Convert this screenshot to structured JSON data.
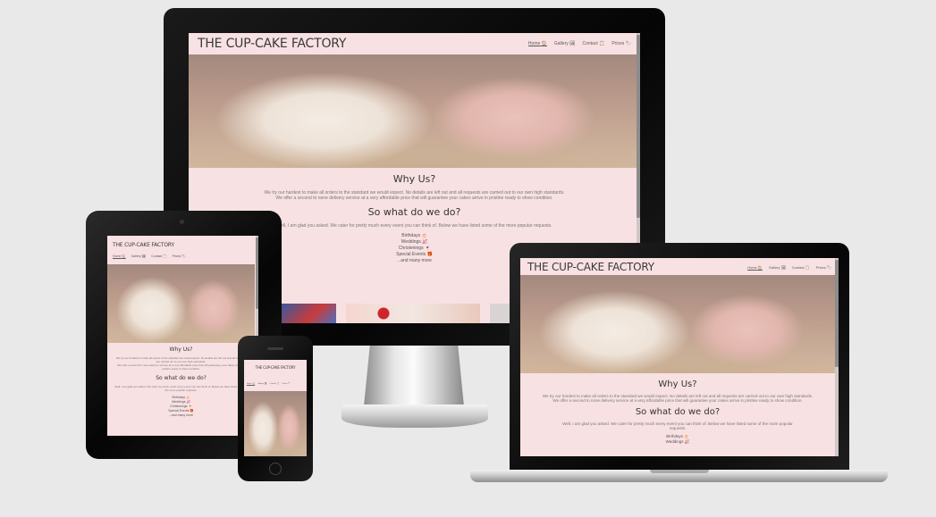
{
  "site": {
    "brand": "THE CUP-CAKE FACTORY",
    "nav": [
      {
        "label": "Home",
        "icon": "🏠",
        "active": true
      },
      {
        "label": "Gallery",
        "icon": "🖼",
        "active": false
      },
      {
        "label": "Contact",
        "icon": "📋",
        "active": false
      },
      {
        "label": "Prices",
        "icon": "🏷",
        "active": false
      }
    ],
    "why_title": "Why Us?",
    "why_text_1": "We try our hardest to make all orders to the standard we would expect. No details are left out and all requests are carried out to our own high standards.",
    "why_text_2": "We offer a second to none delivery service at a very affordable price that will guarantee your cakes arrive in pristine ready to show condition.",
    "what_title": "So what do we do?",
    "what_text": "Well, I am glad you asked. We cater for pretty much every event you can think of. Below we have listed some of the more popular requests.",
    "events": [
      "Birthdays 🎂",
      "Weddings 💒",
      "Christenings 🍷",
      "Special Events 🎁",
      "...and many more"
    ]
  },
  "colors": {
    "page_bg": "#e9e9e9",
    "site_bg": "#f8e1e3",
    "bezel": "#0c0c0c",
    "laptop_body": "#c8c8c8"
  }
}
